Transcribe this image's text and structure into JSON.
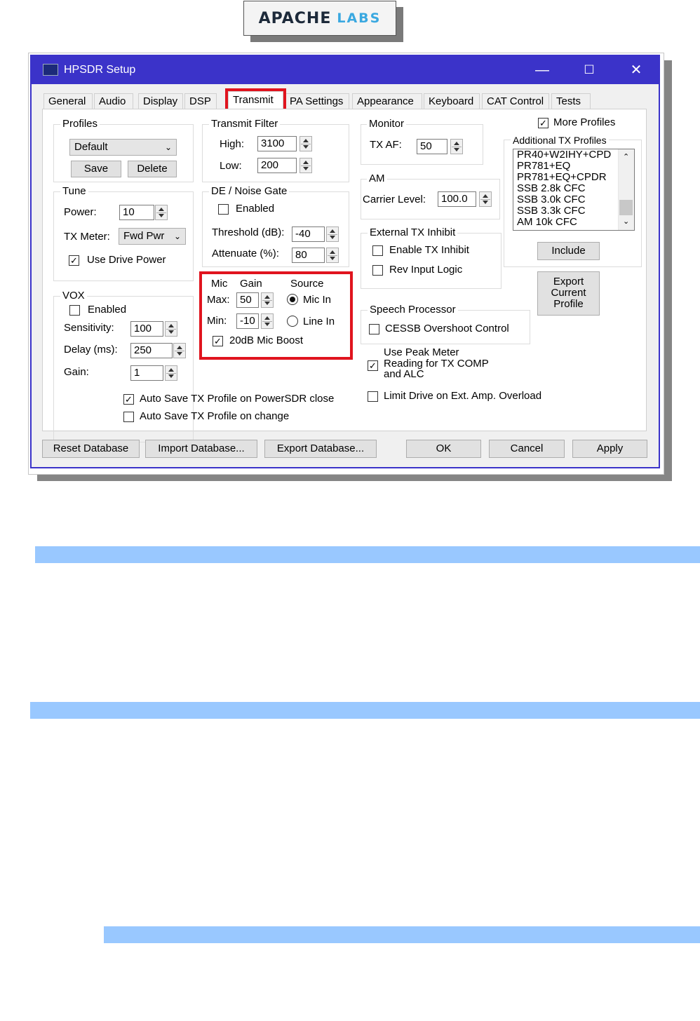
{
  "logo": {
    "text_left": "APACHE",
    "text_right": "LABS"
  },
  "window": {
    "title": "HPSDR Setup",
    "controls": {
      "minimize": "—",
      "maximize": "☐",
      "close": "✕"
    }
  },
  "tabs": [
    "General",
    "Audio",
    "Display",
    "DSP",
    "Transmit",
    "PA Settings",
    "Appearance",
    "Keyboard",
    "CAT Control",
    "Tests"
  ],
  "active_tab": "Transmit",
  "profiles": {
    "title": "Profiles",
    "selected": "Default",
    "save": "Save",
    "delete": "Delete"
  },
  "tune": {
    "title": "Tune",
    "power_label": "Power:",
    "power_value": "10",
    "meter_label": "TX Meter:",
    "meter_value": "Fwd Pwr",
    "use_drive_power": "Use Drive Power",
    "use_drive_power_checked": true
  },
  "vox": {
    "title": "VOX",
    "enabled": "Enabled",
    "enabled_checked": false,
    "sensitivity_label": "Sensitivity:",
    "sensitivity_value": "100",
    "delay_label": "Delay (ms):",
    "delay_value": "250",
    "gain_label": "Gain:",
    "gain_value": "1"
  },
  "transmit_filter": {
    "title": "Transmit Filter",
    "high_label": "High:",
    "high_value": "3100",
    "low_label": "Low:",
    "low_value": "200"
  },
  "noise_gate": {
    "title": "DE / Noise Gate",
    "enabled": "Enabled",
    "enabled_checked": false,
    "threshold_label": "Threshold (dB):",
    "threshold_value": "-40",
    "attenuate_label": "Attenuate (%):",
    "attenuate_value": "80"
  },
  "mic": {
    "header_mic": "Mic",
    "header_gain": "Gain",
    "header_source": "Source",
    "max_label": "Max:",
    "max_value": "50",
    "min_label": "Min:",
    "min_value": "-10",
    "source_mic_in": "Mic In",
    "source_line_in": "Line In",
    "selected_source": "Mic In",
    "boost": "20dB Mic Boost",
    "boost_checked": true
  },
  "auto_save": {
    "on_close": "Auto Save TX Profile on PowerSDR close",
    "on_close_checked": true,
    "on_change": "Auto Save TX Profile on change",
    "on_change_checked": false
  },
  "monitor": {
    "title": "Monitor",
    "tx_af_label": "TX AF:",
    "tx_af_value": "50"
  },
  "am": {
    "title": "AM",
    "carrier_label": "Carrier Level:",
    "carrier_value": "100.0"
  },
  "ext_inhibit": {
    "title": "External TX Inhibit",
    "enable": "Enable TX Inhibit",
    "rev_logic": "Rev Input Logic"
  },
  "speech": {
    "title": "Speech Processor",
    "cessb": "CESSB Overshoot Control"
  },
  "peak_meter": {
    "line1": "Use Peak Meter",
    "line2": "Reading for TX COMP",
    "line3": "and ALC",
    "checked": true
  },
  "limit_drive": {
    "label": "Limit Drive on Ext. Amp. Overload",
    "checked": false
  },
  "more_profiles": {
    "label": "More Profiles",
    "checked": true
  },
  "additional_profiles": {
    "title": "Additional TX Profiles",
    "items": [
      "PR40+W2IHY+CPD",
      "PR781+EQ",
      "PR781+EQ+CPDR",
      "SSB 2.8k CFC",
      "SSB 3.0k CFC",
      "SSB 3.3k CFC",
      "AM 10k CFC"
    ],
    "include": "Include"
  },
  "export_profile": {
    "line1": "Export",
    "line2": "Current",
    "line3": "Profile"
  },
  "bottom": {
    "reset": "Reset Database",
    "import": "Import Database...",
    "export": "Export Database...",
    "ok": "OK",
    "cancel": "Cancel",
    "apply": "Apply"
  },
  "colors": {
    "titlebar": "#3b33c9",
    "highlight": "#e0141e",
    "bluebar": "#99c8ff"
  }
}
